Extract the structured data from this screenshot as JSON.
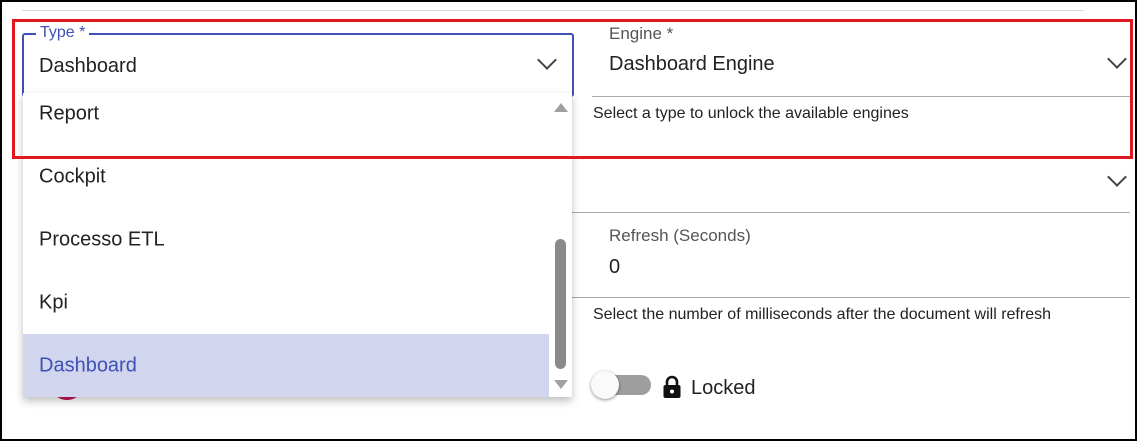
{
  "type_field": {
    "label": "Type *",
    "value": "Dashboard",
    "options": [
      {
        "label": "Report",
        "selected": false
      },
      {
        "label": "Cockpit",
        "selected": false
      },
      {
        "label": "Processo ETL",
        "selected": false
      },
      {
        "label": "Kpi",
        "selected": false
      },
      {
        "label": "Dashboard",
        "selected": true
      }
    ]
  },
  "engine_field": {
    "label": "Engine *",
    "value": "Dashboard Engine",
    "hint": "Select a type to unlock the available engines"
  },
  "refresh_field": {
    "label": "Refresh (Seconds)",
    "value": "0",
    "hint": "Select the number of milliseconds after the document will refresh"
  },
  "lock_toggle": {
    "label": "Locked",
    "checked": false
  },
  "colors": {
    "accent": "#3f51b5",
    "highlight_border": "#e0191f",
    "selected_option_bg": "#d1d5ee",
    "toggle_track": "#9e9e9e"
  },
  "icons": {
    "type_dropdown": "chevron-down-icon",
    "engine_dropdown": "chevron-down-icon",
    "lock": "lock-icon",
    "scroll_up": "arrow-up-icon",
    "scroll_down": "arrow-down-icon"
  }
}
